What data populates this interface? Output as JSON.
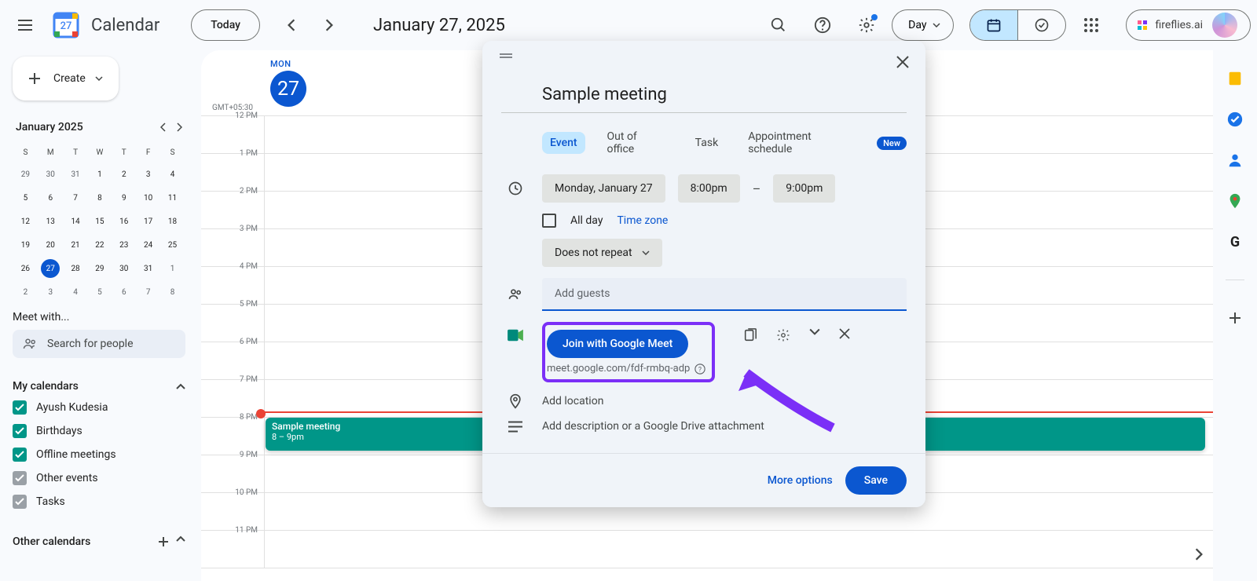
{
  "header": {
    "app_title": "Calendar",
    "today_label": "Today",
    "date_title": "January 27, 2025",
    "view_label": "Day",
    "extension_label": "fireflies.ai"
  },
  "sidebar": {
    "create_label": "Create",
    "mini_cal": {
      "title": "January 2025",
      "dows": [
        "S",
        "M",
        "T",
        "W",
        "T",
        "F",
        "S"
      ],
      "weeks": [
        [
          {
            "d": "29"
          },
          {
            "d": "30"
          },
          {
            "d": "31"
          },
          {
            "d": "1",
            "c": true
          },
          {
            "d": "2",
            "c": true
          },
          {
            "d": "3",
            "c": true
          },
          {
            "d": "4",
            "c": true
          }
        ],
        [
          {
            "d": "5",
            "c": true
          },
          {
            "d": "6",
            "c": true
          },
          {
            "d": "7",
            "c": true
          },
          {
            "d": "8",
            "c": true
          },
          {
            "d": "9",
            "c": true
          },
          {
            "d": "10",
            "c": true
          },
          {
            "d": "11",
            "c": true
          }
        ],
        [
          {
            "d": "12",
            "c": true
          },
          {
            "d": "13",
            "c": true
          },
          {
            "d": "14",
            "c": true
          },
          {
            "d": "15",
            "c": true
          },
          {
            "d": "16",
            "c": true
          },
          {
            "d": "17",
            "c": true
          },
          {
            "d": "18",
            "c": true
          }
        ],
        [
          {
            "d": "19",
            "c": true
          },
          {
            "d": "20",
            "c": true
          },
          {
            "d": "21",
            "c": true
          },
          {
            "d": "22",
            "c": true
          },
          {
            "d": "23",
            "c": true
          },
          {
            "d": "24",
            "c": true
          },
          {
            "d": "25",
            "c": true
          }
        ],
        [
          {
            "d": "26",
            "c": true
          },
          {
            "d": "27",
            "c": true,
            "t": true
          },
          {
            "d": "28",
            "c": true
          },
          {
            "d": "29",
            "c": true
          },
          {
            "d": "30",
            "c": true
          },
          {
            "d": "31",
            "c": true
          },
          {
            "d": "1"
          }
        ],
        [
          {
            "d": "2"
          },
          {
            "d": "3"
          },
          {
            "d": "4"
          },
          {
            "d": "5"
          },
          {
            "d": "6"
          },
          {
            "d": "7"
          },
          {
            "d": "8"
          }
        ]
      ]
    },
    "meet_with": "Meet with...",
    "search_placeholder": "Search for people",
    "my_calendars_label": "My calendars",
    "my_calendars": [
      {
        "label": "Ayush Kudesia",
        "color": "teal"
      },
      {
        "label": "Birthdays",
        "color": "teal"
      },
      {
        "label": "Offline meetings",
        "color": "teal"
      },
      {
        "label": "Other events",
        "color": "gray"
      },
      {
        "label": "Tasks",
        "color": "gray"
      }
    ],
    "other_calendars_label": "Other calendars"
  },
  "grid": {
    "tz": "GMT+05:30",
    "dow": "MON",
    "daynum": "27",
    "hours": [
      "12 PM",
      "1 PM",
      "2 PM",
      "3 PM",
      "4 PM",
      "5 PM",
      "6 PM",
      "7 PM",
      "8 PM",
      "9 PM",
      "10 PM",
      "11 PM"
    ],
    "event": {
      "title": "Sample meeting",
      "time": "8 – 9pm"
    }
  },
  "panel": {
    "title": "Sample meeting",
    "tabs": {
      "event": "Event",
      "ooo": "Out of office",
      "task": "Task",
      "appt": "Appointment schedule",
      "new": "New"
    },
    "date": "Monday, January 27",
    "start": "8:00pm",
    "end": "9:00pm",
    "allday": "All day",
    "timezone": "Time zone",
    "repeat": "Does not repeat",
    "add_guests": "Add guests",
    "meet_btn": "Join with Google Meet",
    "meet_url": "meet.google.com/fdf-rmbq-adp",
    "add_location": "Add location",
    "add_description": "Add description or a Google Drive attachment",
    "more_options": "More options",
    "save": "Save"
  }
}
